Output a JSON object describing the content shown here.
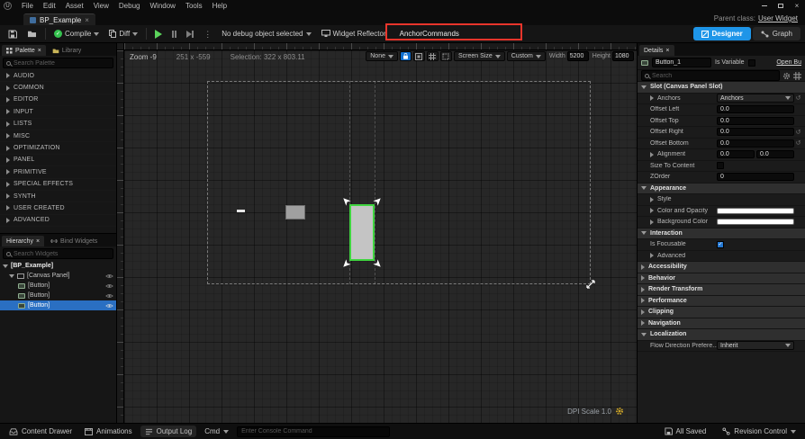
{
  "icons": {
    "logo": "U",
    "close": "×",
    "check": "✓",
    "kebab": "⋮",
    "reset": "↺"
  },
  "menu": {
    "items": [
      "File",
      "Edit",
      "Asset",
      "View",
      "Debug",
      "Window",
      "Tools",
      "Help"
    ],
    "parent_class_label": "Parent class:",
    "parent_class_value": "User Widget"
  },
  "tabs": {
    "asset_tab": "BP_Example"
  },
  "toolbar": {
    "compile": "Compile",
    "diff": "Diff",
    "debug_object": "No debug object selected",
    "widget_reflector": "Widget Reflector",
    "anchor_commands": "AnchorCommands",
    "designer": "Designer",
    "graph": "Graph"
  },
  "palette": {
    "tab": "Palette",
    "library_tab": "Library",
    "search_placeholder": "Search Palette",
    "categories": [
      "AUDIO",
      "COMMON",
      "EDITOR",
      "INPUT",
      "LISTS",
      "MISC",
      "OPTIMIZATION",
      "PANEL",
      "PRIMITIVE",
      "SPECIAL EFFECTS",
      "SYNTH",
      "USER CREATED",
      "ADVANCED"
    ]
  },
  "hierarchy": {
    "tab": "Hierarchy",
    "bind_tab": "Bind Widgets",
    "search_placeholder": "Search Widgets",
    "root": "[BP_Example]",
    "canvas": "[Canvas Panel]",
    "buttons": [
      "[Button]",
      "[Button]",
      "[Button]"
    ]
  },
  "viewport": {
    "zoom": "Zoom -9",
    "cursor": "251 x -559",
    "selection": "Selection: 322 x 803.11",
    "fill_rule": "None",
    "screen_size": "Screen Size",
    "size_preset": "Custom",
    "width_label": "Width",
    "width": "5200",
    "height_label": "Height",
    "height": "1080",
    "dpi": "DPI Scale 1.0"
  },
  "details": {
    "tab": "Details",
    "widget_name": "Button_1",
    "is_variable": "Is Variable",
    "open_link": "Open Bu",
    "search_placeholder": "Search",
    "slot_section": "Slot (Canvas Panel Slot)",
    "anchors_label": "Anchors",
    "anchors_value": "Anchors",
    "offset_left": "Offset Left",
    "offset_left_value": "0.0",
    "offset_top": "Offset Top",
    "offset_top_value": "0.0",
    "offset_right": "Offset Right",
    "offset_right_value": "0.0",
    "offset_bottom": "Offset Bottom",
    "offset_bottom_value": "0.0",
    "alignment_label": "Alignment",
    "alignment_x": "0.0",
    "alignment_y": "0.0",
    "size_to_content": "Size To Content",
    "zorder_label": "ZOrder",
    "zorder_value": "0",
    "appearance_section": "Appearance",
    "style_label": "Style",
    "color_opacity_label": "Color and Opacity",
    "background_color_label": "Background Color",
    "interaction_section": "Interaction",
    "is_focusable": "Is Focusable",
    "advanced_label": "Advanced",
    "accessibility_section": "Accessibility",
    "behavior_section": "Behavior",
    "render_transform_section": "Render Transform",
    "performance_section": "Performance",
    "clipping_section": "Clipping",
    "navigation_section": "Navigation",
    "localization_section": "Localization",
    "flow_direction_label": "Flow Direction Prefere...",
    "flow_direction_value": "Inherit"
  },
  "statusbar": {
    "content_drawer": "Content Drawer",
    "animations": "Animations",
    "output_log": "Output Log",
    "cmd": "Cmd",
    "console_placeholder": "Enter Console Command",
    "all_saved": "All Saved",
    "revision_control": "Revision Control"
  },
  "colors": {
    "accent_blue": "#0f78d1",
    "designer_blue": "#1e95e8",
    "compile_green": "#35c24f",
    "play_green": "#5bd45b",
    "selection_green": "#3fd43f",
    "annotation_red": "#e8352b",
    "selected_row_blue": "#2a6fc2"
  }
}
